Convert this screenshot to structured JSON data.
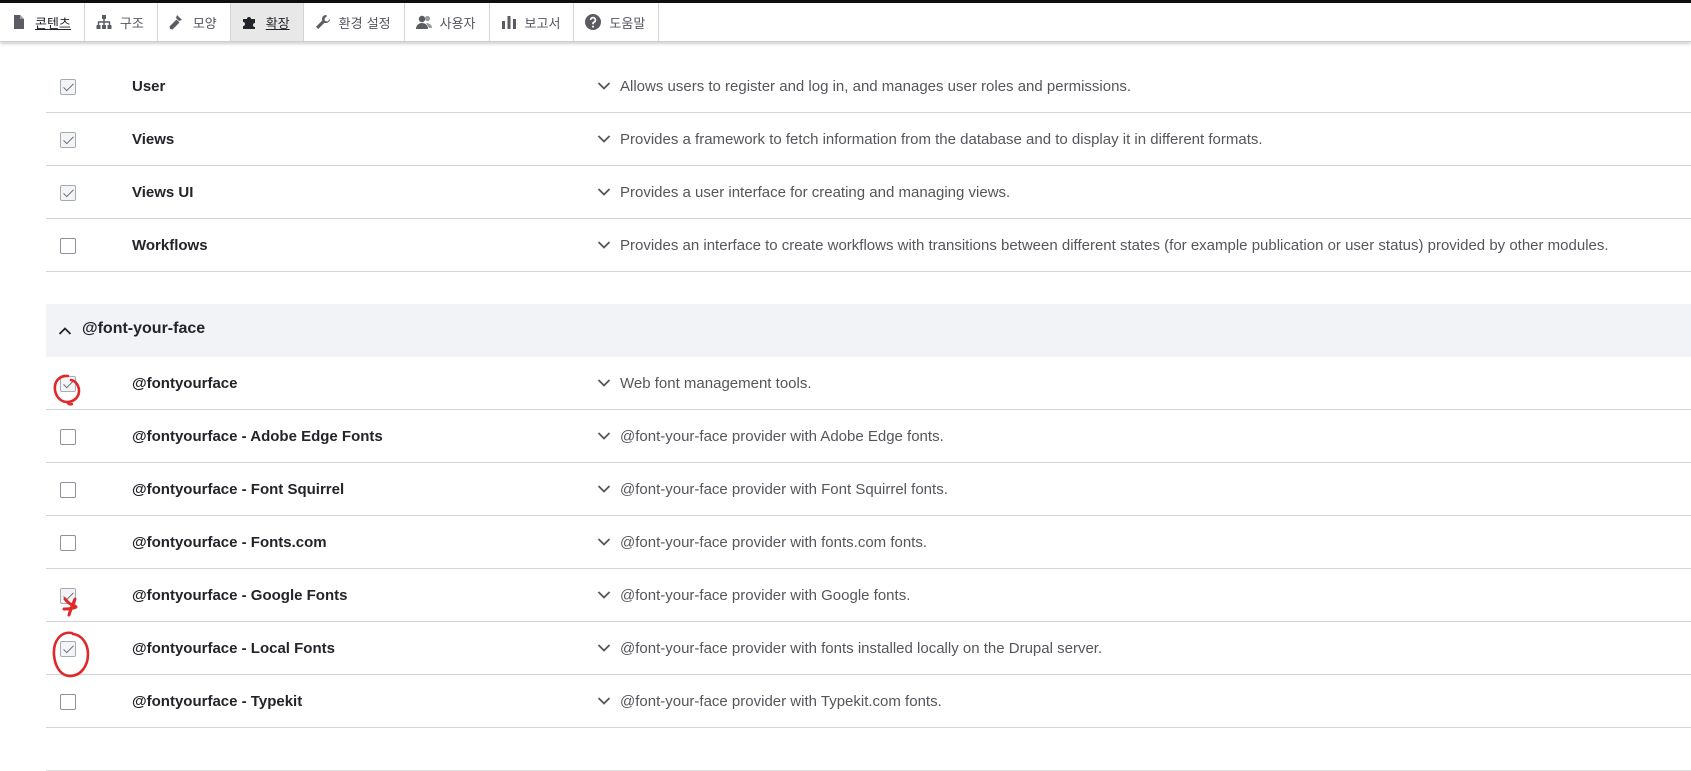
{
  "toolbar": {
    "items": [
      {
        "label": "콘텐츠",
        "icon": "document-icon"
      },
      {
        "label": "구조",
        "icon": "sitemap-icon"
      },
      {
        "label": "모양",
        "icon": "paintbrush-icon"
      },
      {
        "label": "확장",
        "icon": "puzzle-icon"
      },
      {
        "label": "환경 설정",
        "icon": "wrench-icon"
      },
      {
        "label": "사용자",
        "icon": "people-icon"
      },
      {
        "label": "보고서",
        "icon": "bar-chart-icon"
      },
      {
        "label": "도움말",
        "icon": "help-icon"
      }
    ]
  },
  "modules_top": [
    {
      "name": "User",
      "description": "Allows users to register and log in, and manages user roles and permissions.",
      "checked": true
    },
    {
      "name": "Views",
      "description": "Provides a framework to fetch information from the database and to display it in different formats.",
      "checked": true
    },
    {
      "name": "Views UI",
      "description": "Provides a user interface for creating and managing views.",
      "checked": true
    },
    {
      "name": "Workflows",
      "description": "Provides an interface to create workflows with transitions between different states (for example publication or user status) provided by other modules.",
      "checked": false
    }
  ],
  "group": {
    "title": "@font-your-face"
  },
  "modules_group": [
    {
      "name": "@fontyourface",
      "description": "Web font management tools.",
      "checked": true
    },
    {
      "name": "@fontyourface - Adobe Edge Fonts",
      "description": "@font-your-face provider with Adobe Edge fonts.",
      "checked": false
    },
    {
      "name": "@fontyourface - Font Squirrel",
      "description": "@font-your-face provider with Font Squirrel fonts.",
      "checked": false
    },
    {
      "name": "@fontyourface - Fonts.com",
      "description": "@font-your-face provider with fonts.com fonts.",
      "checked": false
    },
    {
      "name": "@fontyourface - Google Fonts",
      "description": "@font-your-face provider with Google fonts.",
      "checked": true
    },
    {
      "name": "@fontyourface - Local Fonts",
      "description": "@font-your-face provider with fonts installed locally on the Drupal server.",
      "checked": true
    },
    {
      "name": "@fontyourface - Typekit",
      "description": "@font-your-face provider with Typekit.com fonts.",
      "checked": false
    }
  ],
  "colors": {
    "annotation": "#e0272a",
    "group_header_bg": "#f2f3f7"
  }
}
